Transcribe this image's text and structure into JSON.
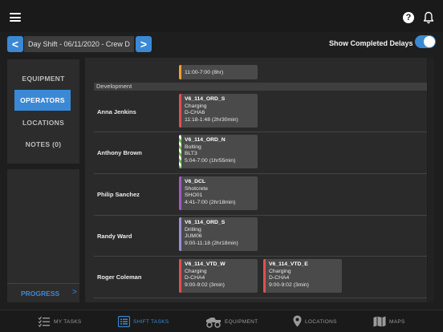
{
  "header": {
    "menu_icon": "hamburger-menu-icon",
    "help_icon": "help-circle-icon",
    "help_glyph": "?",
    "notifications_icon": "bell-icon"
  },
  "shift": {
    "prev_glyph": "<",
    "next_glyph": ">",
    "label": "Day Shift - 06/11/2020 - Crew D",
    "show_completed_label": "Show Completed Delays",
    "show_completed_on": true
  },
  "sidebar": {
    "items": [
      {
        "label": "EQUIPMENT",
        "active": false
      },
      {
        "label": "OPERATORS",
        "active": true
      },
      {
        "label": "LOCATIONS",
        "active": false
      },
      {
        "label": "NOTES (0)",
        "active": false
      }
    ],
    "progress_label": "PROGRESS",
    "progress_arrow": ">"
  },
  "timeline": {
    "top_partial_task": {
      "time": "11:00-7:00 (8hr)",
      "color": "#f0a030"
    },
    "section": "Development",
    "rows": [
      {
        "name": "Anna Jenkins",
        "tasks": [
          {
            "code": "V6_114_ORD_S",
            "activity": "Charging",
            "location": "D-CHA6",
            "time": "11:18-1:48 (2hr30min)",
            "color": "#e0504f",
            "striped": false
          }
        ]
      },
      {
        "name": "Anthony Brown",
        "tasks": [
          {
            "code": "V6_114_ORD_N",
            "activity": "Bolting",
            "location": "BLT3",
            "time": "5:04-7:00 (1hr55min)",
            "color": "#6fbf4c",
            "striped": true
          }
        ]
      },
      {
        "name": "Philip Sanchez",
        "tasks": [
          {
            "code": "V6_DCL",
            "activity": "Shotcrete",
            "location": "SHO01",
            "time": "4:41-7:00 (2hr18min)",
            "color": "#a05cc0",
            "striped": false
          }
        ]
      },
      {
        "name": "Randy Ward",
        "tasks": [
          {
            "code": "V6_114_ORD_S",
            "activity": "Drilling",
            "location": "JUM06",
            "time": "9:00-11:18 (2hr18min)",
            "color": "#9b8fd8",
            "striped": false
          }
        ]
      },
      {
        "name": "Roger Coleman",
        "tasks": [
          {
            "code": "V6_114_VTD_W",
            "activity": "Charging",
            "location": "D-CHA4",
            "time": "9:00-9:02 (3min)",
            "color": "#e0504f",
            "striped": false
          },
          {
            "code": "V6_114_VTD_E",
            "activity": "Charging",
            "location": "D-CHA4",
            "time": "9:00-9:02 (3min)",
            "color": "#e0504f",
            "striped": false
          }
        ]
      }
    ]
  },
  "tabs": [
    {
      "label": "MY TASKS",
      "icon": "checklist-icon",
      "active": false
    },
    {
      "label": "SHIFT TASKS",
      "icon": "list-icon",
      "active": true
    },
    {
      "label": "EQUIPMENT",
      "icon": "loader-icon",
      "active": false
    },
    {
      "label": "LOCATIONS",
      "icon": "location-pin-icon",
      "active": false
    },
    {
      "label": "MAPS",
      "icon": "map-icon",
      "active": false
    }
  ],
  "colors": {
    "accent": "#3b89d4",
    "background": "#1e1e1e",
    "panel": "#2c2c2c"
  }
}
